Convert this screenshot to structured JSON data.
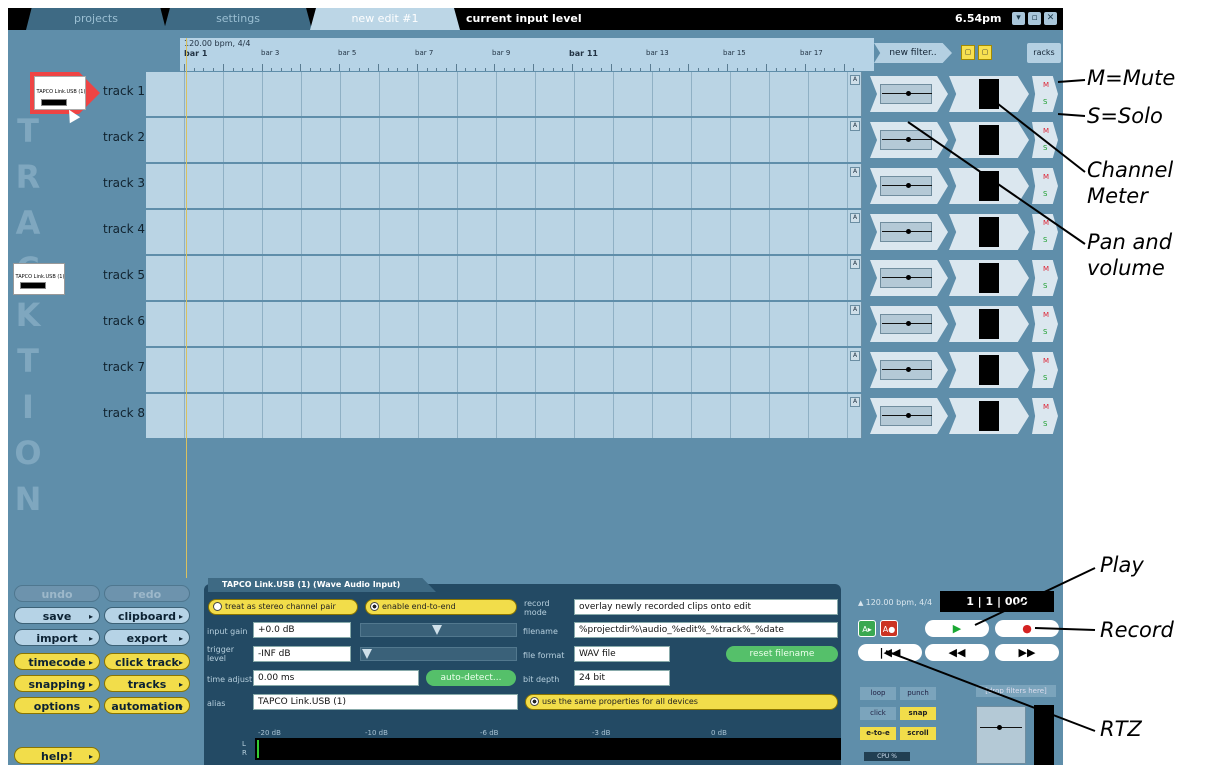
{
  "titlebar": {
    "tabs": [
      "projects",
      "settings",
      "new edit #1"
    ],
    "input_level": "current input level",
    "clock": "6.54pm"
  },
  "ruler": {
    "tempo": "120.00 bpm, 4/4",
    "bars": [
      "bar 1",
      "bar 3",
      "bar 5",
      "bar 7",
      "bar 9",
      "bar 11",
      "bar 13",
      "bar 15",
      "bar 17"
    ]
  },
  "toolbar": {
    "new_filter": "new filter..",
    "racks": "racks"
  },
  "watermark": [
    "T",
    "R",
    "A",
    "C",
    "K",
    "T",
    "I",
    "O",
    "N"
  ],
  "tracks": [
    {
      "name": "track 1"
    },
    {
      "name": "track 2"
    },
    {
      "name": "track 3"
    },
    {
      "name": "track 4"
    },
    {
      "name": "track 5"
    },
    {
      "name": "track 6"
    },
    {
      "name": "track 7"
    },
    {
      "name": "track 8"
    }
  ],
  "track_buttons": {
    "auto": "A",
    "mute": "M",
    "solo": "S"
  },
  "device": {
    "label": "TAPCO Link.USB (1)"
  },
  "left_buttons": {
    "undo": "undo",
    "redo": "redo",
    "save": "save",
    "clipboard": "clipboard",
    "import": "import",
    "export": "export",
    "timecode": "timecode",
    "click_track": "click track",
    "snapping": "snapping",
    "tracks": "tracks",
    "options": "options",
    "automation": "automation",
    "help": "help!"
  },
  "panel": {
    "title": "TAPCO Link.USB (1) (Wave Audio Input)",
    "stereo": "treat as stereo channel pair",
    "end_to_end": "enable end-to-end",
    "record_mode_label": "record mode",
    "record_mode_value": "overlay newly recorded clips onto edit",
    "input_gain_label": "input gain",
    "input_gain_value": "+0.0 dB",
    "filename_label": "filename",
    "filename_value": "%projectdir%\\audio_%edit%_%track%_%date",
    "trigger_label": "trigger level",
    "trigger_value": "-INF dB",
    "file_format_label": "file format",
    "file_format_value": "WAV file",
    "reset_filename": "reset filename",
    "time_adjust_label": "time adjust",
    "time_adjust_value": "0.00 ms",
    "auto_detect": "auto-detect...",
    "bit_depth_label": "bit depth",
    "bit_depth_value": "24 bit",
    "alias_label": "alias",
    "alias_value": "TAPCO Link.USB (1)",
    "same_props": "use the same properties for all devices",
    "db_scale": [
      "-20 dB",
      "-10 dB",
      "-6 dB",
      "-3 dB",
      "0 dB"
    ],
    "meter_channels": [
      "L",
      "R"
    ]
  },
  "transport": {
    "tempo": "120.00 bpm, 4/4",
    "counter": "1 | 1 | 000",
    "loop": "loop",
    "punch": "punch",
    "click": "click",
    "snap": "snap",
    "e_to_e": "e-to-e",
    "scroll": "scroll",
    "cpu": "CPU %",
    "snap_filter": "[drop filters here]"
  },
  "annotations": {
    "mute": "M=Mute",
    "solo": "S=Solo",
    "channel_meter": "Channel\nMeter",
    "pan_volume": "Pan and\nvolume",
    "play": "Play",
    "record": "Record",
    "rtz": "RTZ"
  },
  "colors": {
    "background": "#5f8eaa",
    "lane": "#bad4e4",
    "yellow_button": "#f2dd4a",
    "record_red": "#d42222",
    "play_green": "#1aa833"
  }
}
